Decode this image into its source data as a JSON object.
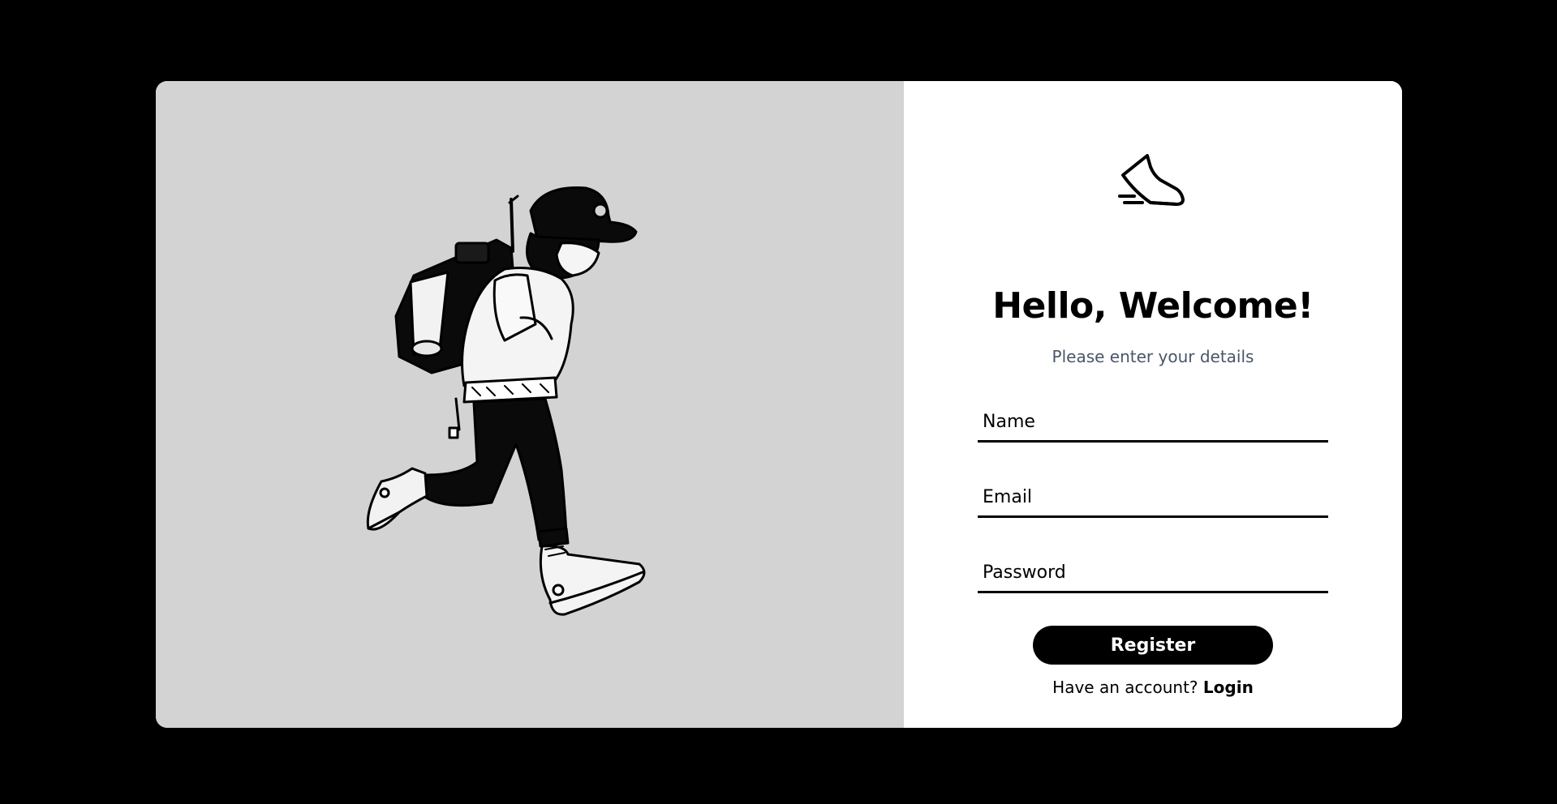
{
  "hero": {
    "illustration_icon": "running-hiker-illustration"
  },
  "logo": {
    "icon": "sneaker-icon"
  },
  "form": {
    "title": "Hello, Welcome!",
    "subtitle": "Please enter your details",
    "name_placeholder": "Name",
    "email_placeholder": "Email",
    "password_placeholder": "Password",
    "register_label": "Register",
    "account_prompt": "Have an account?",
    "login_label": "Login"
  },
  "colors": {
    "page_background": "#000000",
    "hero_background": "#d3d3d3",
    "card_background": "#ffffff",
    "accent": "#000000",
    "subtitle_color": "#4a5567"
  }
}
